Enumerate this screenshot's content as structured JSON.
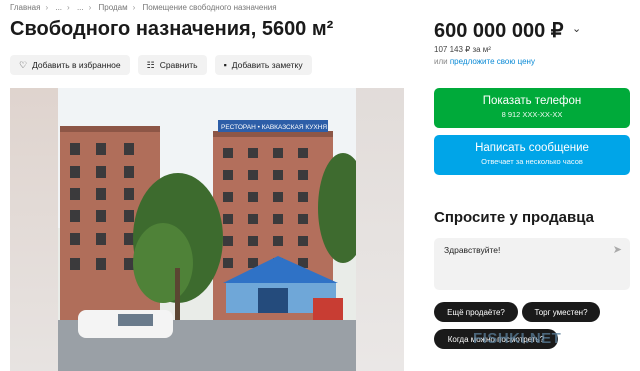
{
  "breadcrumb": [
    "Главная",
    "...",
    "...",
    "Продам",
    "Помещение свободного назначения"
  ],
  "listing": {
    "title": "Свободного назначения, 5600 м²",
    "price": "600 000 000 ₽",
    "price_per_m2": "107 143 ₽ за м²",
    "credit_prefix": "или",
    "credit_link": "предложите свою цену"
  },
  "actions": {
    "favorite": "Добавить в избранное",
    "compare": "Сравнить",
    "note": "Добавить заметку"
  },
  "contact": {
    "phone_label": "Показать телефон",
    "phone_masked": "8 912 XXX-XX-XX",
    "message_label": "Написать сообщение",
    "message_sub": "Отвечает за несколько часов"
  },
  "ask": {
    "heading": "Спросите у продавца",
    "message_text": "Здравствуйте!",
    "chips": [
      "Ещё продаёте?",
      "Торг уместен?",
      "Когда можно посмотреть?"
    ]
  },
  "photo": {
    "sign_text": "РЕСТОРАН • КАВКАЗСКАЯ КУХНЯ"
  },
  "watermark": "FISHKI.NET",
  "colors": {
    "phone_button": "#00aa3a",
    "message_button": "#00a5e8",
    "link": "#0a8ad6"
  }
}
